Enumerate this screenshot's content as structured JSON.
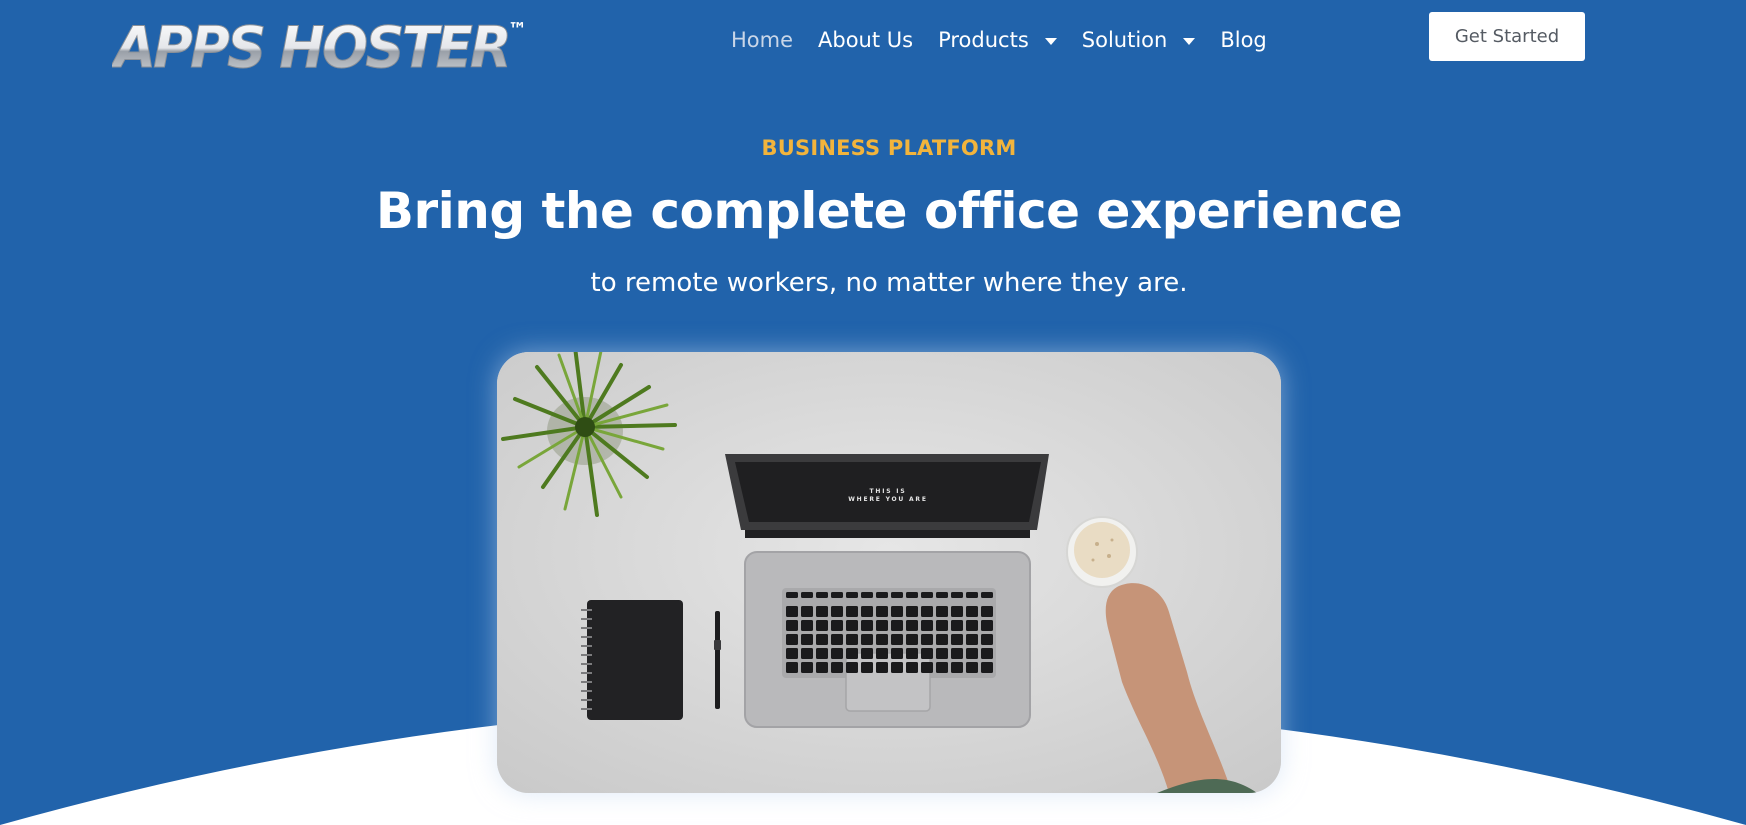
{
  "brand": {
    "logo_text": "APPS HOSTER",
    "trademark": "™"
  },
  "nav": {
    "items": [
      {
        "label": "Home",
        "active": true,
        "dropdown": false
      },
      {
        "label": "About Us",
        "active": false,
        "dropdown": false
      },
      {
        "label": "Products",
        "active": false,
        "dropdown": true
      },
      {
        "label": "Solution",
        "active": false,
        "dropdown": true
      },
      {
        "label": "Blog",
        "active": false,
        "dropdown": false
      }
    ],
    "dropdown_icon": "caret-down-icon"
  },
  "header": {
    "cta_label": "Get Started"
  },
  "hero": {
    "eyebrow": "BUSINESS PLATFORM",
    "headline": "Bring the complete office experience",
    "subheadline": "to remote workers, no matter where they are.",
    "image_screen_text_line1": "THIS IS",
    "image_screen_text_line2": "WHERE YOU ARE"
  },
  "colors": {
    "background": "#2163ab",
    "accent": "#f2b43c",
    "text": "#ffffff",
    "wave": "#ffffff"
  }
}
